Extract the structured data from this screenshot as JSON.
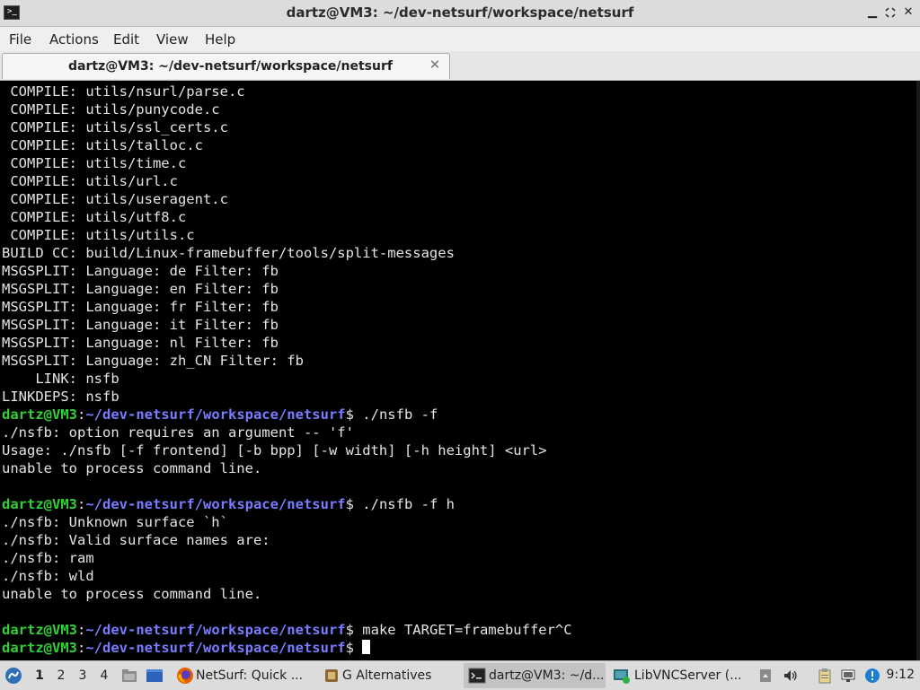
{
  "window": {
    "title": "dartz@VM3: ~/dev-netsurf/workspace/netsurf",
    "icon": "terminal-icon",
    "controls": {
      "minimize": "▁",
      "maximize": "⛶",
      "close": "✕"
    }
  },
  "menu": {
    "items": [
      {
        "label": "File"
      },
      {
        "label": "Actions"
      },
      {
        "label": "Edit"
      },
      {
        "label": "View"
      },
      {
        "label": "Help"
      }
    ]
  },
  "tab": {
    "label": "dartz@VM3: ~/dev-netsurf/workspace/netsurf",
    "close": "✕"
  },
  "terminal": {
    "colors": {
      "background": "#000000",
      "text": "#e4e4e4",
      "user_host": "#2ed136",
      "path": "#7a7cff"
    },
    "lines": [
      [
        {
          "t": " COMPILE: utils/nsurl/parse.c"
        }
      ],
      [
        {
          "t": " COMPILE: utils/punycode.c"
        }
      ],
      [
        {
          "t": " COMPILE: utils/ssl_certs.c"
        }
      ],
      [
        {
          "t": " COMPILE: utils/talloc.c"
        }
      ],
      [
        {
          "t": " COMPILE: utils/time.c"
        }
      ],
      [
        {
          "t": " COMPILE: utils/url.c"
        }
      ],
      [
        {
          "t": " COMPILE: utils/useragent.c"
        }
      ],
      [
        {
          "t": " COMPILE: utils/utf8.c"
        }
      ],
      [
        {
          "t": " COMPILE: utils/utils.c"
        }
      ],
      [
        {
          "t": "BUILD CC: build/Linux-framebuffer/tools/split-messages"
        }
      ],
      [
        {
          "t": "MSGSPLIT: Language: de Filter: fb"
        }
      ],
      [
        {
          "t": "MSGSPLIT: Language: en Filter: fb"
        }
      ],
      [
        {
          "t": "MSGSPLIT: Language: fr Filter: fb"
        }
      ],
      [
        {
          "t": "MSGSPLIT: Language: it Filter: fb"
        }
      ],
      [
        {
          "t": "MSGSPLIT: Language: nl Filter: fb"
        }
      ],
      [
        {
          "t": "MSGSPLIT: Language: zh_CN Filter: fb"
        }
      ],
      [
        {
          "t": "    LINK: nsfb"
        }
      ],
      [
        {
          "t": "LINKDEPS: nsfb"
        }
      ],
      [
        {
          "t": "dartz@VM3",
          "c": "g"
        },
        {
          "t": ":"
        },
        {
          "t": "~/dev-netsurf/workspace/netsurf",
          "c": "b"
        },
        {
          "t": "$ ./nsfb -f"
        }
      ],
      [
        {
          "t": "./nsfb: option requires an argument -- 'f'"
        }
      ],
      [
        {
          "t": "Usage: ./nsfb [-f frontend] [-b bpp] [-w width] [-h height] <url>"
        }
      ],
      [
        {
          "t": "unable to process command line."
        }
      ],
      [
        {
          "t": ""
        }
      ],
      [
        {
          "t": "dartz@VM3",
          "c": "g"
        },
        {
          "t": ":"
        },
        {
          "t": "~/dev-netsurf/workspace/netsurf",
          "c": "b"
        },
        {
          "t": "$ ./nsfb -f h"
        }
      ],
      [
        {
          "t": "./nsfb: Unknown surface `h`"
        }
      ],
      [
        {
          "t": "./nsfb: Valid surface names are:"
        }
      ],
      [
        {
          "t": "./nsfb: ram"
        }
      ],
      [
        {
          "t": "./nsfb: wld"
        }
      ],
      [
        {
          "t": "unable to process command line."
        }
      ],
      [
        {
          "t": ""
        }
      ],
      [
        {
          "t": "dartz@VM3",
          "c": "g"
        },
        {
          "t": ":"
        },
        {
          "t": "~/dev-netsurf/workspace/netsurf",
          "c": "b"
        },
        {
          "t": "$ make TARGET=framebuffer^C"
        }
      ],
      [
        {
          "t": "dartz@VM3",
          "c": "g"
        },
        {
          "t": ":"
        },
        {
          "t": "~/dev-netsurf/workspace/netsurf",
          "c": "b"
        },
        {
          "t": "$ "
        },
        {
          "cursor": true
        }
      ]
    ]
  },
  "taskbar": {
    "start_icon": "lxqt-start-icon",
    "workspaces": [
      "1",
      "2",
      "3",
      "4"
    ],
    "active_workspace": "1",
    "quicklaunch": [
      "file-manager-icon",
      "show-desktop-icon"
    ],
    "tasks": [
      {
        "label": "NetSurf: Quick ...",
        "icon": "firefox-icon",
        "active": false
      },
      {
        "label": "G Alternatives",
        "icon": "alternatives-icon",
        "active": false
      },
      {
        "label": "dartz@VM3: ~/d...",
        "icon": "terminal-icon",
        "active": true
      },
      {
        "label": "LibVNCServer (...",
        "icon": "vnc-icon",
        "active": false
      }
    ],
    "tray": [
      "removable-media-icon",
      "volume-icon",
      "clipboard-icon",
      "network-icon",
      "updates-icon"
    ],
    "clock": "9:12"
  }
}
